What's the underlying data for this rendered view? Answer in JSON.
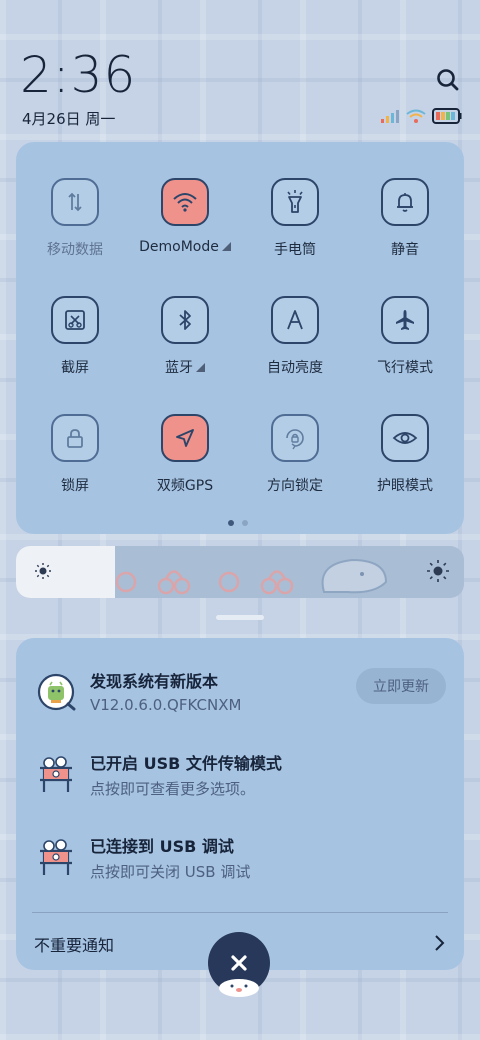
{
  "status": {
    "time": "2:36",
    "date": "4月26日 周一"
  },
  "quick_settings": {
    "tiles": [
      {
        "label": "移动数据",
        "icon": "mobile-data-icon",
        "state": "off-dim"
      },
      {
        "label": "DemoMode",
        "icon": "wifi-icon",
        "state": "on",
        "has_menu": true
      },
      {
        "label": "手电筒",
        "icon": "flashlight-icon",
        "state": "off"
      },
      {
        "label": "静音",
        "icon": "bell-icon",
        "state": "off"
      },
      {
        "label": "截屏",
        "icon": "screenshot-icon",
        "state": "off"
      },
      {
        "label": "蓝牙",
        "icon": "bluetooth-icon",
        "state": "off",
        "has_menu": true
      },
      {
        "label": "自动亮度",
        "icon": "auto-brightness-icon",
        "state": "off"
      },
      {
        "label": "飞行模式",
        "icon": "airplane-icon",
        "state": "off"
      },
      {
        "label": "锁屏",
        "icon": "lock-icon",
        "state": "off"
      },
      {
        "label": "双频GPS",
        "icon": "gps-icon",
        "state": "on"
      },
      {
        "label": "方向锁定",
        "icon": "rotation-lock-icon",
        "state": "off"
      },
      {
        "label": "护眼模式",
        "icon": "eye-icon",
        "state": "off"
      }
    ],
    "page_count": 2,
    "active_page": 1
  },
  "brightness": {
    "level_fraction": 0.22
  },
  "notifications": [
    {
      "title": "发现系统有新版本",
      "subtitle": "V12.0.6.0.QFKCNXM",
      "icon": "system-update-icon",
      "action": "立即更新"
    },
    {
      "title": "已开启 USB 文件传输模式",
      "subtitle": "点按即可查看更多选项。",
      "icon": "usb-icon"
    },
    {
      "title": "已连接到 USB 调试",
      "subtitle": "点按即可关闭 USB 调试",
      "icon": "usb-debug-icon"
    }
  ],
  "unimportant_label": "不重要通知",
  "colors": {
    "panel": "#a6c3e2",
    "tile_on": "#f0928c",
    "tile_border": "#2c4569"
  }
}
